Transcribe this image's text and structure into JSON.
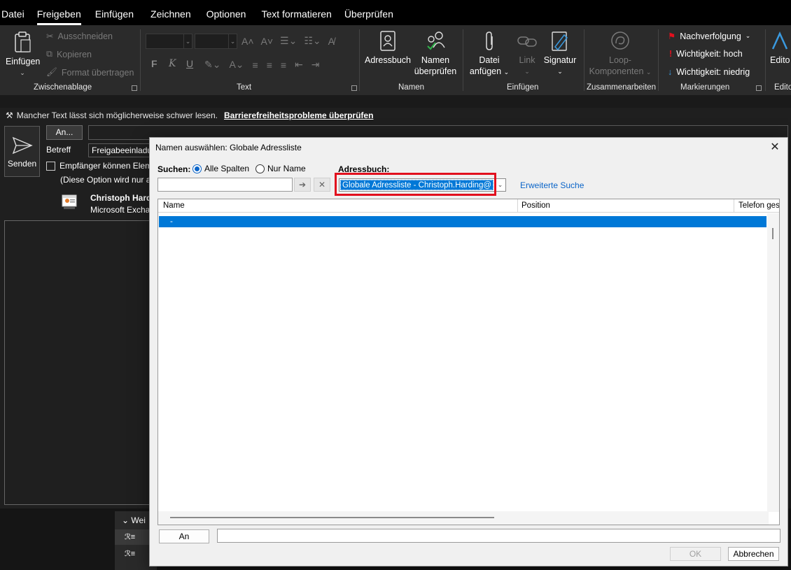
{
  "menu": [
    "Datei",
    "Freigeben",
    "Einfügen",
    "Zeichnen",
    "Optionen",
    "Text formatieren",
    "Überprüfen"
  ],
  "menu_active": "Freigeben",
  "ribbon": {
    "clipboard": {
      "paste": "Einfügen",
      "cut": "Ausschneiden",
      "copy": "Kopieren",
      "format_painter": "Format übertragen",
      "group": "Zwischenablage"
    },
    "text": {
      "bold": "F",
      "italic": "K",
      "underline": "U",
      "group": "Text"
    },
    "names": {
      "address_book": "Adressbuch",
      "check_names_1": "Namen",
      "check_names_2": "überprüfen",
      "group": "Namen"
    },
    "insert": {
      "attach_1": "Datei",
      "attach_2": "anfügen",
      "link": "Link",
      "signature": "Signatur",
      "group": "Einfügen"
    },
    "collaborate": {
      "loop_1": "Loop-",
      "loop_2": "Komponenten",
      "group": "Zusammenarbeiten"
    },
    "tags": {
      "followup": "Nachverfolgung",
      "high": "Wichtigkeit: hoch",
      "low": "Wichtigkeit: niedrig",
      "group": "Markierungen"
    },
    "editor": {
      "label": "Edito",
      "group": "Edito"
    }
  },
  "accessibility": {
    "message": "Mancher Text lässt sich möglicherweise schwer lesen.",
    "link": "Barrierefreiheitsprobleme überprüfen"
  },
  "compose": {
    "send": "Senden",
    "to_button": "An...",
    "subject_label": "Betreff",
    "subject_value": "Freigabeeinladu",
    "permission_text": "Empfänger können Eleme",
    "permission_note": "(Diese Option wird nur a",
    "sender_name": "Christoph Hardi",
    "sender_org": "Microsoft Exchar"
  },
  "bottom_panel": {
    "header": "Wei"
  },
  "dialog": {
    "title": "Namen auswählen: Globale Adressliste",
    "search_label": "Suchen:",
    "radio_all": "Alle Spalten",
    "radio_name": "Nur Name",
    "address_book_label": "Adressbuch:",
    "address_book_value": "Globale Adressliste - Christoph.Harding@",
    "advanced_search": "Erweiterte Suche",
    "columns": [
      "Name",
      "Position",
      "Telefon ges"
    ],
    "rows": [
      "-"
    ],
    "to_button": "An",
    "ok": "OK",
    "cancel": "Abbrechen"
  },
  "colors": {
    "highlight": "#0078d7",
    "red_box": "#e2101e",
    "link": "#0a64c8"
  }
}
